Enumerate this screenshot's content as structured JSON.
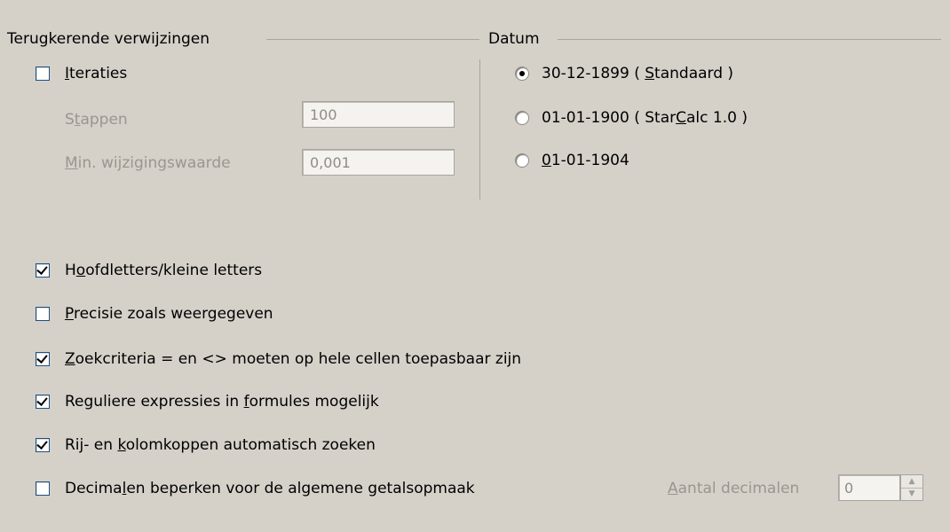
{
  "iterations_group": {
    "title": "Terugkerende verwijzingen",
    "iterations": {
      "pre": "",
      "ul": "I",
      "post": "teraties",
      "checked": false
    },
    "steps": {
      "pre": "S",
      "ul": "t",
      "post": "appen",
      "value": "100"
    },
    "min_change": {
      "pre": "",
      "ul": "M",
      "post": "in. wijzigingswaarde",
      "value": "0,001"
    }
  },
  "date_group": {
    "title": "Datum",
    "options": [
      {
        "pre": "30-12-1899 ( ",
        "ul": "S",
        "post": "tandaard )",
        "selected": true
      },
      {
        "pre": "01-01-1900 ( Star",
        "ul": "C",
        "post": "alc 1.0 )",
        "selected": false
      },
      {
        "pre": "",
        "ul": "0",
        "post": "1-01-1904",
        "selected": false
      }
    ]
  },
  "options": [
    {
      "pre": "H",
      "ul": "o",
      "post": "ofdletters/kleine letters",
      "checked": true
    },
    {
      "pre": "",
      "ul": "P",
      "post": "recisie zoals weergegeven",
      "checked": false
    },
    {
      "pre": "",
      "ul": "Z",
      "post": "oekcriteria = en <> moeten op hele cellen toepasbaar zijn",
      "checked": true
    },
    {
      "pre": "Reguliere expressies in ",
      "ul": "f",
      "post": "ormules mogelijk",
      "checked": true
    },
    {
      "pre": "Rij- en ",
      "ul": "k",
      "post": "olomkoppen automatisch zoeken",
      "checked": true
    },
    {
      "pre": "Decima",
      "ul": "l",
      "post": "en beperken voor de algemene getalsopmaak",
      "checked": false
    }
  ],
  "decimals": {
    "pre": "",
    "ul": "A",
    "post": "antal decimalen",
    "value": "0"
  },
  "icons": {
    "spin_up": "spin-up-arrow-icon",
    "spin_down": "spin-down-arrow-icon"
  }
}
